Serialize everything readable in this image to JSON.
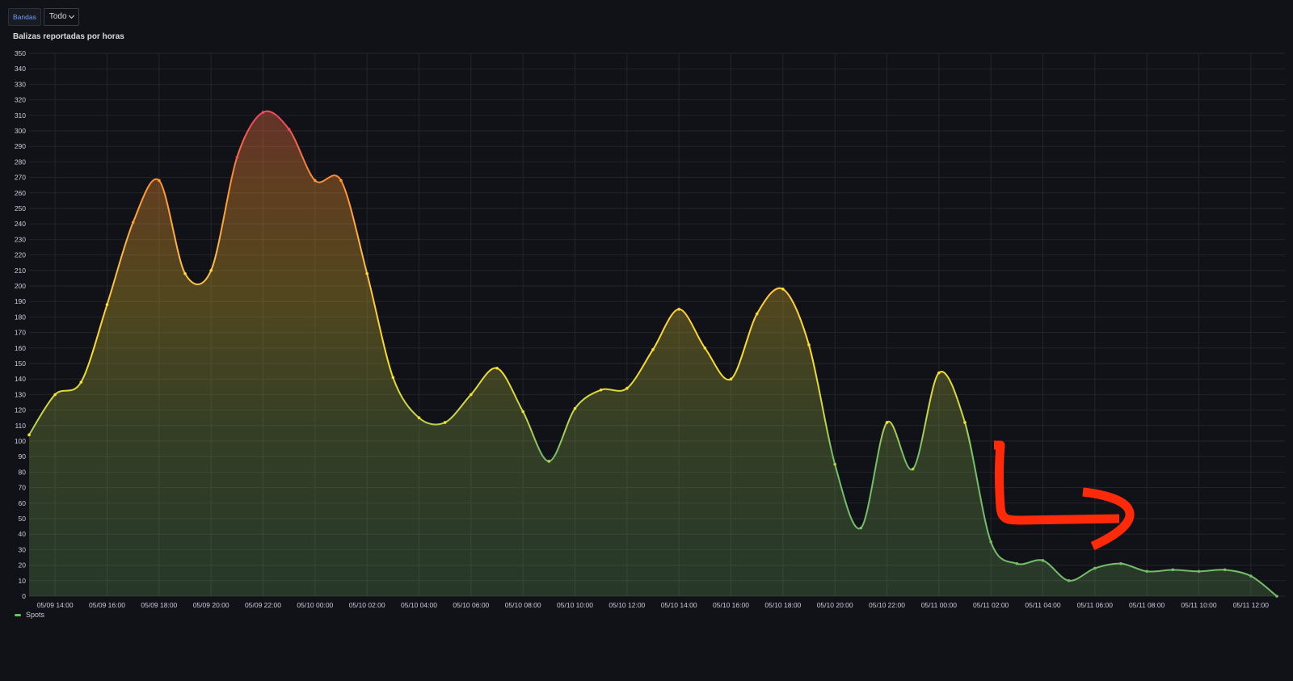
{
  "toolbar": {
    "tag_label": "Bandas",
    "select_value": "Todo",
    "chevron_icon": "chevron-down-icon"
  },
  "panel": {
    "title": "Balizas reportadas por horas"
  },
  "annotation": {
    "color": "#ff2a0a",
    "shape": "hand-drawn arrow"
  },
  "chart_data": {
    "type": "area",
    "title": "Balizas reportadas por horas",
    "xlabel": "",
    "ylabel": "",
    "ylim": [
      0,
      350
    ],
    "yticks": [
      0,
      10,
      20,
      30,
      40,
      50,
      60,
      70,
      80,
      90,
      100,
      110,
      120,
      130,
      140,
      150,
      160,
      170,
      180,
      190,
      200,
      210,
      220,
      230,
      240,
      250,
      260,
      270,
      280,
      290,
      300,
      310,
      320,
      330,
      340,
      350
    ],
    "x_range": [
      "05/09 13:00",
      "05/11 13:00"
    ],
    "x_tick_labels": [
      "05/09 14:00",
      "05/09 16:00",
      "05/09 18:00",
      "05/09 20:00",
      "05/09 22:00",
      "05/10 00:00",
      "05/10 02:00",
      "05/10 04:00",
      "05/10 06:00",
      "05/10 08:00",
      "05/10 10:00",
      "05/10 12:00",
      "05/10 14:00",
      "05/10 16:00",
      "05/10 18:00",
      "05/10 20:00",
      "05/10 22:00",
      "05/11 00:00",
      "05/11 02:00",
      "05/11 04:00",
      "05/11 06:00",
      "05/11 08:00",
      "05/11 10:00",
      "05/11 12:00"
    ],
    "grid": true,
    "legend_position": "bottom-left",
    "color_scheme": [
      "#73bf69",
      "#fade2a",
      "#ff9830",
      "#f2495c"
    ],
    "series": [
      {
        "name": "Spots",
        "x": [
          "05/09 13:00",
          "05/09 14:00",
          "05/09 15:00",
          "05/09 16:00",
          "05/09 17:00",
          "05/09 18:00",
          "05/09 19:00",
          "05/09 20:00",
          "05/09 21:00",
          "05/09 22:00",
          "05/09 23:00",
          "05/10 00:00",
          "05/10 01:00",
          "05/10 02:00",
          "05/10 03:00",
          "05/10 04:00",
          "05/10 05:00",
          "05/10 06:00",
          "05/10 07:00",
          "05/10 08:00",
          "05/10 09:00",
          "05/10 10:00",
          "05/10 11:00",
          "05/10 12:00",
          "05/10 13:00",
          "05/10 14:00",
          "05/10 15:00",
          "05/10 16:00",
          "05/10 17:00",
          "05/10 18:00",
          "05/10 19:00",
          "05/10 20:00",
          "05/10 21:00",
          "05/10 22:00",
          "05/10 23:00",
          "05/11 00:00",
          "05/11 01:00",
          "05/11 02:00",
          "05/11 03:00",
          "05/11 04:00",
          "05/11 05:00",
          "05/11 06:00",
          "05/11 07:00",
          "05/11 08:00",
          "05/11 09:00",
          "05/11 10:00",
          "05/11 11:00",
          "05/11 12:00",
          "05/11 13:00"
        ],
        "values": [
          104,
          130,
          138,
          188,
          241,
          268,
          208,
          210,
          283,
          312,
          301,
          268,
          268,
          208,
          141,
          115,
          112,
          130,
          147,
          119,
          87,
          121,
          133,
          134,
          159,
          185,
          160,
          140,
          182,
          198,
          162,
          85,
          44,
          112,
          82,
          144,
          112,
          35,
          21,
          23,
          10,
          18,
          21,
          16,
          17,
          16,
          17,
          13,
          0
        ]
      }
    ]
  }
}
